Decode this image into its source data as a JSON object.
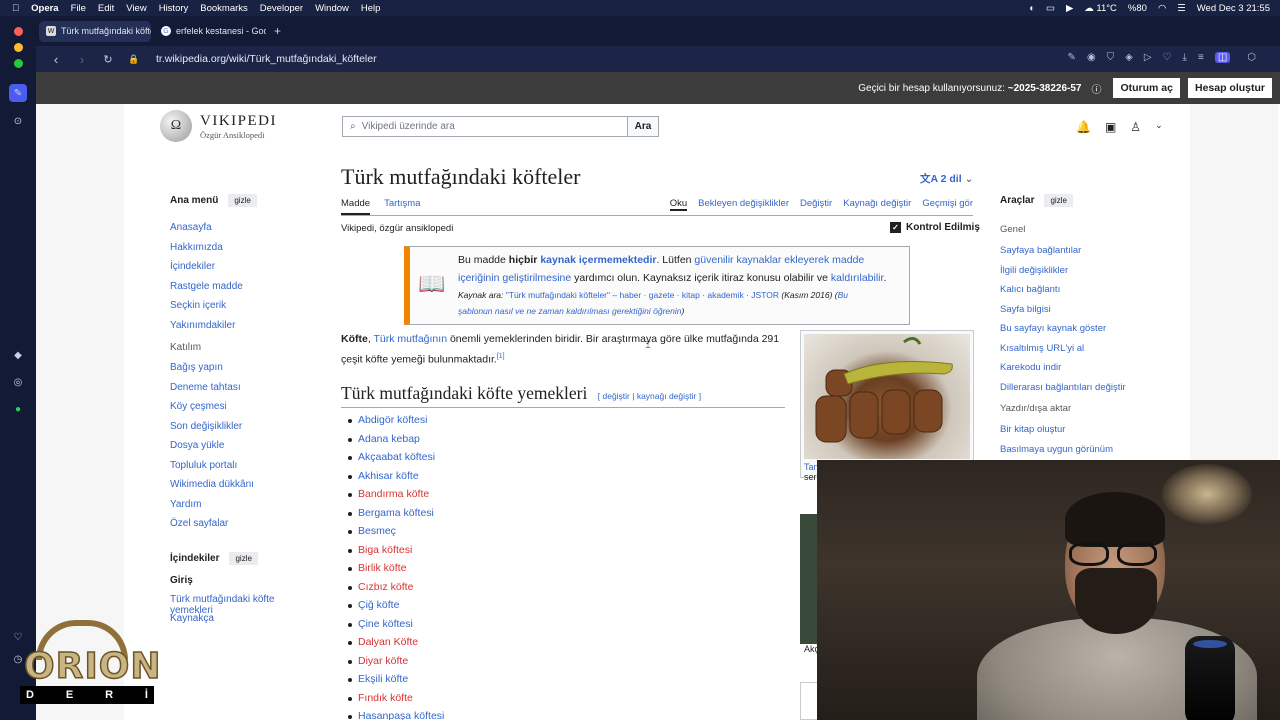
{
  "menubar": {
    "apple": "",
    "items": [
      "Opera",
      "File",
      "Edit",
      "View",
      "History",
      "Bookmarks",
      "Developer",
      "Window",
      "Help"
    ],
    "weather": "11°C",
    "battery": "%80",
    "datetime": "Wed Dec 3  21:55"
  },
  "tabs": [
    {
      "title": "Türk mutfağındaki köfte"
    },
    {
      "title": "erfelek kestanesi - Goog"
    }
  ],
  "address": {
    "url": "tr.wikipedia.org/wiki/Türk_mutfağındaki_köfteler"
  },
  "notice": {
    "text": "Geçici bir hesap kullanıyorsunuz:",
    "user": "~2025-38226-57",
    "login": "Oturum aç",
    "create": "Hesap oluştur"
  },
  "wiki": {
    "logo_title": "VIKIPEDI",
    "logo_sub": "Özgür Ansiklopedi",
    "search_placeholder": "Vikipedi üzerinde ara",
    "search_button": "Ara",
    "title": "Türk mutfağındaki köfteler",
    "languages": "2 dil",
    "tab_article": "Madde",
    "tab_talk": "Tartışma",
    "tab_read": "Oku",
    "tab_pending": "Bekleyen değişiklikler",
    "tab_edit": "Değiştir",
    "tab_source": "Kaynağı değiştir",
    "tab_history": "Geçmişi gör",
    "tagline": "Vikipedi, özgür ansiklopedi",
    "checked": "Kontrol Edilmiş"
  },
  "ambox": {
    "l1a": "Bu madde ",
    "l1b": "hiçbir",
    "l1c": "kaynak içermemektedir",
    "l1d": ". Lütfen ",
    "l1e": "güvenilir kaynaklar ekleyerek madde",
    "l2a": "içeriğinin geliştirilmesine",
    "l2b": " yardımcı olun. Kaynaksız içerik itiraz konusu olabilir ve ",
    "l2c": "kaldırılabilir",
    "l2d": ".",
    "l3a": "Kaynak ara: ",
    "l3b": "\"Türk mutfağındaki köfteler\" – haber · gazete · kitap · akademik · JSTOR",
    "l3c": " (Kasım 2016) (",
    "l3d": "Bu",
    "l4": "şablonun nasıl ve ne zaman kaldırılması gerektiğini öğrenin",
    "l4b": ")"
  },
  "lead": {
    "a": "Köfte",
    "b": ", ",
    "c": "Türk mutfağının",
    "d": " önemli yemeklerinden biridir. Bir araştırmaya göre ülke mutfağında 291 çeşit köfte yemeği bulunmaktadır.",
    "ref": "[1]"
  },
  "section": {
    "title": "Türk mutfağındaki köfte yemekleri",
    "edit": "[ değiştir | kaynağı değiştir ]"
  },
  "dishes": [
    {
      "name": "Abdigör köftesi",
      "color": "#3366cc"
    },
    {
      "name": "Adana kebap",
      "color": "#3366cc"
    },
    {
      "name": "Akçaabat köftesi",
      "color": "#3366cc"
    },
    {
      "name": "Akhisar köfte",
      "color": "#3366cc"
    },
    {
      "name": "Bandırma köfte",
      "color": "#d73333"
    },
    {
      "name": "Bergama köftesi",
      "color": "#3366cc"
    },
    {
      "name": "Besmeç",
      "color": "#3366cc"
    },
    {
      "name": "Biga köftesi",
      "color": "#d73333"
    },
    {
      "name": "Birlik köfte",
      "color": "#d73333"
    },
    {
      "name": "Cızbız köfte",
      "color": "#d73333"
    },
    {
      "name": "Çiğ köfte",
      "color": "#3366cc"
    },
    {
      "name": "Çine köftesi",
      "color": "#3366cc"
    },
    {
      "name": "Dalyan Köfte",
      "color": "#d73333"
    },
    {
      "name": "Diyar köfte",
      "color": "#d73333"
    },
    {
      "name": "Ekşili köfte",
      "color": "#3366cc"
    },
    {
      "name": "Fındık köfte",
      "color": "#d73333"
    },
    {
      "name": "Hasanpaşa köftesi",
      "color": "#3366cc"
    }
  ],
  "main_menu": {
    "head": "Ana menü",
    "hide": "gizle",
    "links1": [
      "Anasayfa",
      "Hakkımızda",
      "İçindekiler",
      "Rastgele madde",
      "Seçkin içerik",
      "Yakınımdakiler"
    ],
    "participation": "Katılım",
    "links2": [
      "Bağış yapın",
      "Deneme tahtası",
      "Köy çeşmesi",
      "Son değişiklikler",
      "Dosya yükle",
      "Topluluk portalı",
      "Wikimedia dükkânı",
      "Yardım",
      "Özel sayfalar"
    ]
  },
  "toc": {
    "head": "İçindekiler",
    "hide": "gizle",
    "intro": "Giriş",
    "items": [
      "Türk mutfağındaki köfte yemekleri",
      "Kaynakça"
    ]
  },
  "tools": {
    "head": "Araçlar",
    "hide": "gizle",
    "general": "Genel",
    "links1": [
      "Sayfaya bağlantılar",
      "İlgili değişiklikler",
      "Kalıcı bağlantı",
      "Sayfa bilgisi",
      "Bu sayfayı kaynak göster",
      "Kısaltılmış URL'yi al",
      "Karekodu indir",
      "Dillerarası bağlantıları değiştir"
    ],
    "export": "Yazdır/dışa aktar",
    "links2": [
      "Bir kitap oluştur",
      "Basılmaya uygun görünüm"
    ]
  },
  "thumb": {
    "caption1": "Tan",
    "caption1b": "ser",
    "caption2": "Akç"
  },
  "watermark": {
    "brand": "ORION",
    "letters": [
      "D",
      "E",
      "R",
      "İ"
    ]
  }
}
